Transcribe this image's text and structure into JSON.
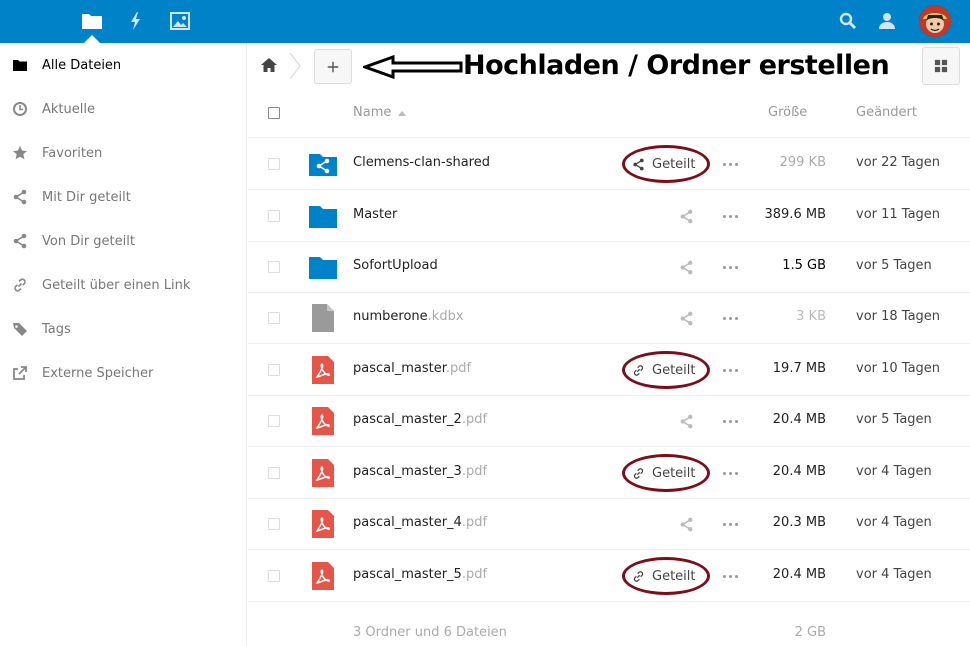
{
  "header": {
    "icons": [
      "folder-icon",
      "activity-icon",
      "gallery-icon",
      "search-icon",
      "contacts-icon"
    ],
    "avatar": "avatar"
  },
  "sidebar": {
    "items": [
      {
        "label": "Alle Dateien",
        "icon": "folder-icon",
        "active": true
      },
      {
        "label": "Aktuelle",
        "icon": "clock-icon",
        "active": false
      },
      {
        "label": "Favoriten",
        "icon": "star-icon",
        "active": false
      },
      {
        "label": "Mit Dir geteilt",
        "icon": "share-icon",
        "active": false
      },
      {
        "label": "Von Dir geteilt",
        "icon": "share-icon",
        "active": false
      },
      {
        "label": "Geteilt über einen Link",
        "icon": "link-icon",
        "active": false
      },
      {
        "label": "Tags",
        "icon": "tag-icon",
        "active": false
      },
      {
        "label": "Externe Speicher",
        "icon": "external-icon",
        "active": false
      }
    ]
  },
  "controls": {
    "add_label": "+",
    "annotation": "Hochladen / Ordner erstellen"
  },
  "table": {
    "headers": {
      "name": "Name",
      "size": "Größe",
      "modified": "Geändert"
    },
    "rows": [
      {
        "name": "Clemens-clan-shared",
        "ext": "",
        "type": "shared-folder",
        "size": "299 KB",
        "date": "vor 22 Tagen",
        "share": "shared",
        "share_label": "Geteilt",
        "circled": true,
        "size_color": "#aaaaaa"
      },
      {
        "name": "Master",
        "ext": "",
        "type": "folder",
        "size": "389.6 MB",
        "date": "vor 11 Tagen",
        "share": "none",
        "share_label": "",
        "circled": false,
        "size_color": "#222222"
      },
      {
        "name": "SofortUpload",
        "ext": "",
        "type": "folder",
        "size": "1.5 GB",
        "date": "vor 5 Tagen",
        "share": "none",
        "share_label": "",
        "circled": false,
        "size_color": "#000000"
      },
      {
        "name": "numberone",
        "ext": ".kdbx",
        "type": "file",
        "size": "3 KB",
        "date": "vor 18 Tagen",
        "share": "none",
        "share_label": "",
        "circled": false,
        "size_color": "#bbbbbb"
      },
      {
        "name": "pascal_master",
        "ext": ".pdf",
        "type": "pdf",
        "size": "19.7 MB",
        "date": "vor 10 Tagen",
        "share": "link",
        "share_label": "Geteilt",
        "circled": true,
        "size_color": "#222222"
      },
      {
        "name": "pascal_master_2",
        "ext": ".pdf",
        "type": "pdf",
        "size": "20.4 MB",
        "date": "vor 5 Tagen",
        "share": "none",
        "share_label": "",
        "circled": false,
        "size_color": "#222222"
      },
      {
        "name": "pascal_master_3",
        "ext": ".pdf",
        "type": "pdf",
        "size": "20.4 MB",
        "date": "vor 4 Tagen",
        "share": "link",
        "share_label": "Geteilt",
        "circled": true,
        "size_color": "#222222"
      },
      {
        "name": "pascal_master_4",
        "ext": ".pdf",
        "type": "pdf",
        "size": "20.3 MB",
        "date": "vor 4 Tagen",
        "share": "none",
        "share_label": "",
        "circled": false,
        "size_color": "#222222"
      },
      {
        "name": "pascal_master_5",
        "ext": ".pdf",
        "type": "pdf",
        "size": "20.4 MB",
        "date": "vor 4 Tagen",
        "share": "link",
        "share_label": "Geteilt",
        "circled": true,
        "size_color": "#222222"
      }
    ],
    "summary": {
      "text": "3 Ordner und 6 Dateien",
      "size": "2 GB"
    }
  },
  "colors": {
    "header": "#0082c9",
    "folder": "#0082c9",
    "pdf": "#e4554a",
    "annotation_circle": "#7a0f19"
  }
}
